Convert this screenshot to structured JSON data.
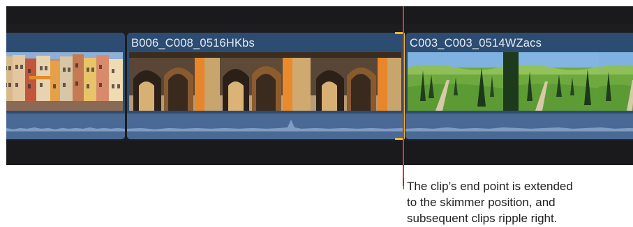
{
  "timeline": {
    "clips": [
      {
        "title": "",
        "kind": "colorful-town-houses"
      },
      {
        "title": "B006_C008_0516HKbs",
        "kind": "arched-corridor"
      },
      {
        "title": "C003_C003_0514WZacs",
        "kind": "cypress-hills"
      }
    ],
    "selection": {
      "edge": "end",
      "color": "#f3b62a"
    },
    "skimmer": {
      "color": "#d8372d"
    }
  },
  "callout": {
    "lines": [
      "The clip’s end point is extended",
      "to the skimmer position, and",
      "subsequent clips ripple right."
    ]
  },
  "colors": {
    "timeline_bg": "#1d1d1f",
    "clip_bg": "#2d4c72",
    "audio_bg": "#4a6a95",
    "clip_title": "#e6edf6"
  }
}
